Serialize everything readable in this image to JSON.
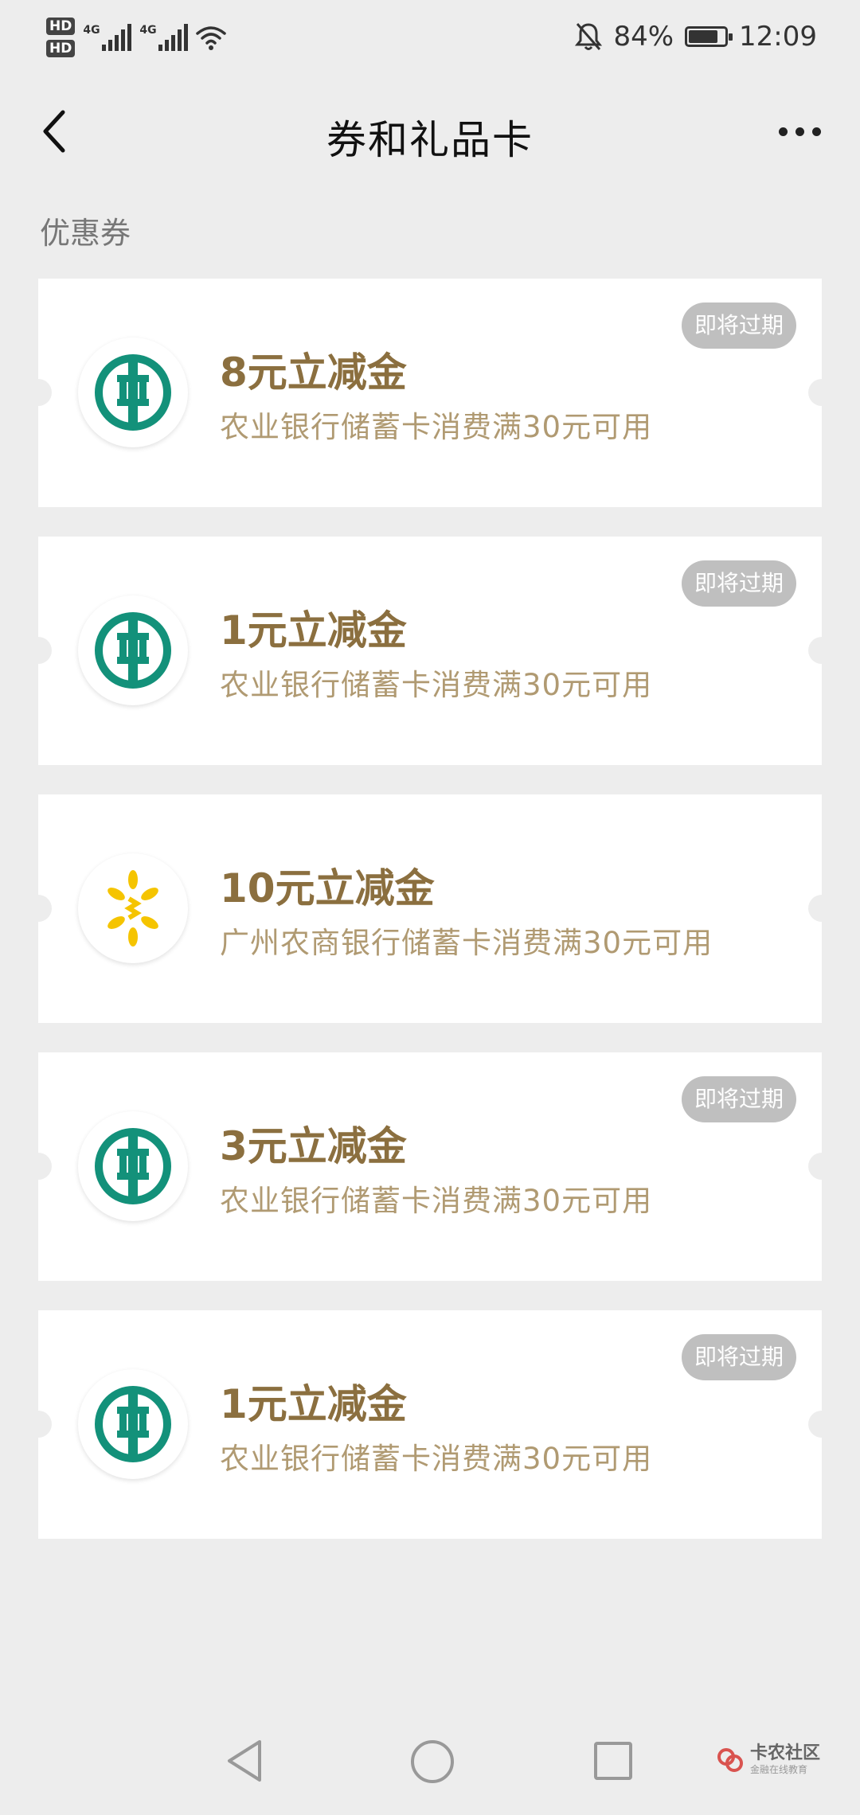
{
  "status_bar": {
    "hd1": "HD",
    "hd2": "HD",
    "net1": "4G",
    "net2": "4G",
    "battery_text": "84%",
    "battery_level": 0.84,
    "time": "12:09",
    "icons": [
      "mute-bell-icon",
      "wifi-icon",
      "signal-icon",
      "battery-icon"
    ]
  },
  "nav": {
    "title": "券和礼品卡",
    "back_icon": "chevron-left-icon",
    "more_icon": "more-dots-icon"
  },
  "section": {
    "title": "优惠券"
  },
  "coupons": [
    {
      "title": "8元立减金",
      "desc": "农业银行储蓄卡消费满30元可用",
      "badge": "即将过期",
      "logo": "abc-bank-logo"
    },
    {
      "title": "1元立减金",
      "desc": "农业银行储蓄卡消费满30元可用",
      "badge": "即将过期",
      "logo": "abc-bank-logo"
    },
    {
      "title": "10元立减金",
      "desc": "广州农商银行储蓄卡消费满30元可用",
      "badge": "",
      "logo": "grcb-logo"
    },
    {
      "title": "3元立减金",
      "desc": "农业银行储蓄卡消费满30元可用",
      "badge": "即将过期",
      "logo": "abc-bank-logo"
    },
    {
      "title": "1元立减金",
      "desc": "农业银行储蓄卡消费满30元可用",
      "badge": "即将过期",
      "logo": "abc-bank-logo"
    }
  ],
  "watermark": {
    "main": "卡农社区",
    "sub": "金融在线教育"
  },
  "colors": {
    "background": "#ededed",
    "coupon_title": "#8b6f3f",
    "coupon_desc": "#b09a72",
    "badge_bg": "#bfbfbf",
    "abc_green": "#13917a",
    "grcb_yellow": "#f5c400"
  }
}
